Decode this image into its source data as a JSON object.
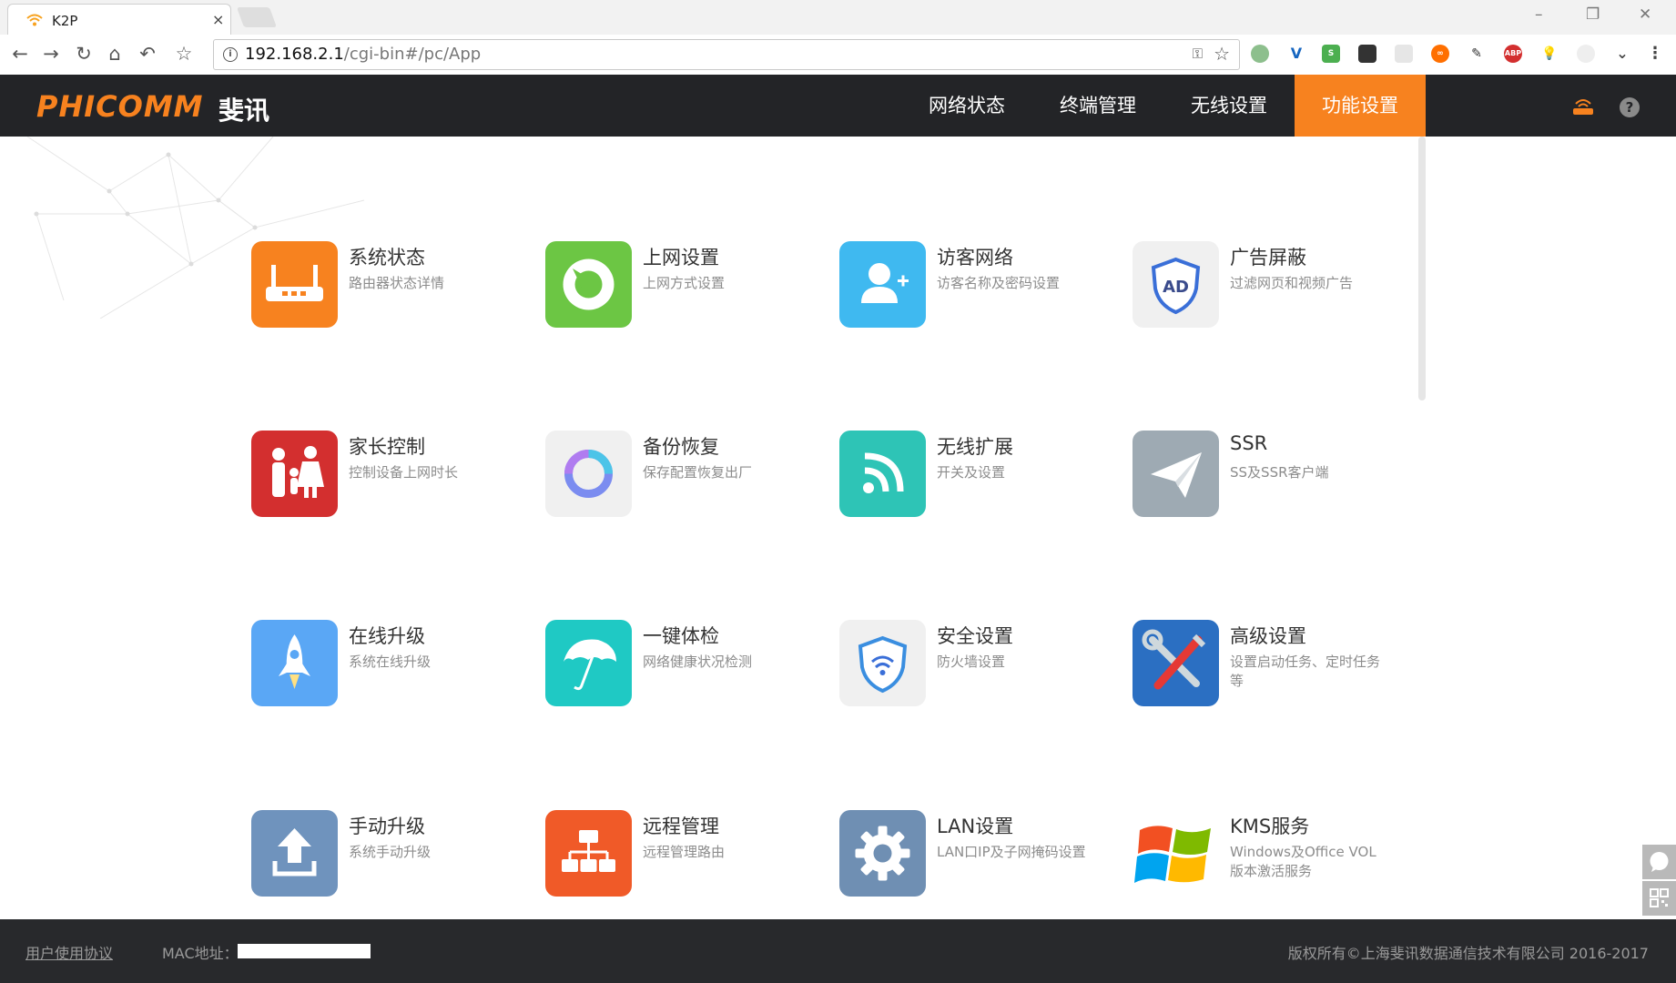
{
  "browser": {
    "tab_title": "K2P",
    "tab_close": "×",
    "url_host": "192.168.2.1",
    "url_path": "/cgi-bin#/pc/App"
  },
  "header": {
    "logo_text": "PHICOMM",
    "logo_cn": "斐讯",
    "nav": [
      {
        "label": "网络状态"
      },
      {
        "label": "终端管理"
      },
      {
        "label": "无线设置"
      },
      {
        "label": "功能设置",
        "active": true
      }
    ],
    "accent_color": "#f7821f"
  },
  "cards": [
    {
      "title": "系统状态",
      "desc": "路由器状态详情",
      "icon": "router-icon",
      "color": "#f7821f"
    },
    {
      "title": "上网设置",
      "desc": "上网方式设置",
      "icon": "internet-settings-icon",
      "color": "#6cc644"
    },
    {
      "title": "访客网络",
      "desc": "访客名称及密码设置",
      "icon": "guest-user-icon",
      "color": "#3fb9f0"
    },
    {
      "title": "广告屏蔽",
      "desc": "过滤网页和视频广告",
      "icon": "ad-block-shield-icon",
      "color": "#f0f0f0"
    },
    {
      "title": "家长控制",
      "desc": "控制设备上网时长",
      "icon": "parents-child-icon",
      "color": "#d32f2f"
    },
    {
      "title": "备份恢复",
      "desc": "保存配置恢复出厂",
      "icon": "backup-ring-icon",
      "color": "#f0f0f0"
    },
    {
      "title": "无线扩展",
      "desc": "开关及设置",
      "icon": "wireless-signal-icon",
      "color": "#2ec4b6"
    },
    {
      "title": "SSR",
      "desc": "SS及SSR客户端",
      "icon": "paper-plane-icon",
      "color": "#9eaab3"
    },
    {
      "title": "在线升级",
      "desc": "系统在线升级",
      "icon": "rocket-icon",
      "color": "#5aa7f5"
    },
    {
      "title": "一键体检",
      "desc": "网络健康状况检测",
      "icon": "umbrella-icon",
      "color": "#1fc9c4"
    },
    {
      "title": "安全设置",
      "desc": "防火墙设置",
      "icon": "security-shield-icon",
      "color": "#f0f0f0"
    },
    {
      "title": "高级设置",
      "desc": "设置启动任务、定时任务等",
      "icon": "tools-icon",
      "color": "#2b6fc2"
    },
    {
      "title": "手动升级",
      "desc": "系统手动升级",
      "icon": "upload-arrow-icon",
      "color": "#6f93bd"
    },
    {
      "title": "远程管理",
      "desc": "远程管理路由",
      "icon": "network-tree-icon",
      "color": "#f05a28"
    },
    {
      "title": "LAN设置",
      "desc": "LAN口IP及子网掩码设置",
      "icon": "gear-icon",
      "color": "#6f8fb3"
    },
    {
      "title": "KMS服务",
      "desc": "Windows及Office VOL版本激活服务",
      "icon": "windows-logo-icon",
      "color": "#ffffff"
    }
  ],
  "footer": {
    "agreement": "用户使用协议",
    "mac_label": "MAC地址：",
    "copyright": "版权所有©上海斐讯数据通信技术有限公司 2016-2017"
  }
}
